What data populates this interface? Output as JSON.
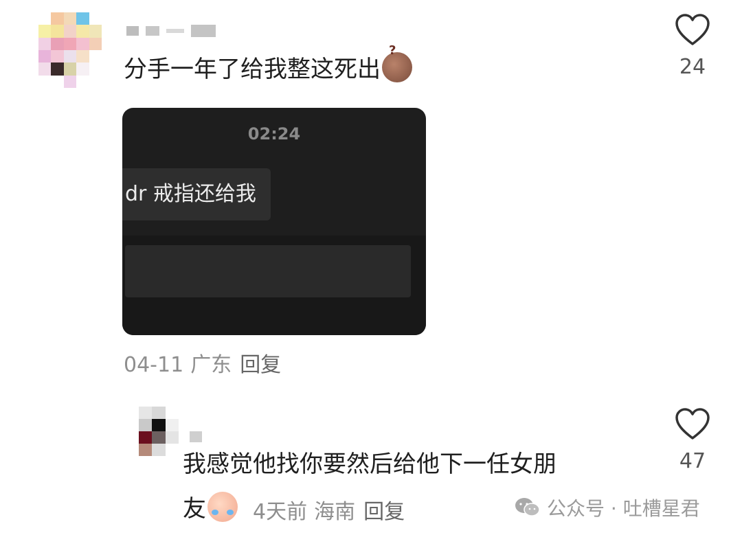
{
  "comment": {
    "text": "分手一年了给我整这死出",
    "emoji": "grimace-bag-emoji",
    "likes": "24",
    "date": "04-11",
    "location": "广东",
    "reply_label": "回复"
  },
  "screenshot": {
    "time": "02:24",
    "message": "dr 戒指还给我"
  },
  "reply": {
    "text_line1": "我感觉他找你要然后给他下一任女朋",
    "text_line2": "友",
    "emoji": "crying-laugh-emoji",
    "likes": "47",
    "time_ago": "4天前",
    "location": "海南",
    "reply_label": "回复"
  },
  "watermark": {
    "text": "公众号 · 吐槽星君",
    "icon": "wechat-icon"
  },
  "colors": {
    "background": "#ffffff",
    "text": "#1f1f1f",
    "meta": "#8e8e8e",
    "screenshot_bg": "#1e1e1e"
  }
}
